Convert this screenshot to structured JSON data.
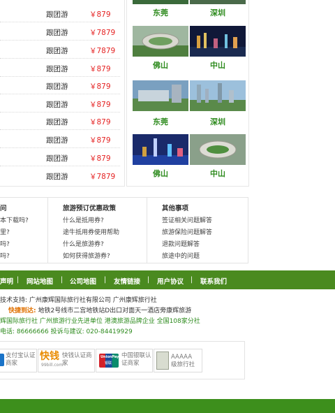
{
  "tours": [
    {
      "type": "跟团游",
      "price": "￥879"
    },
    {
      "type": "跟团游",
      "price": "￥7879"
    },
    {
      "type": "跟团游",
      "price": "￥7879"
    },
    {
      "type": "跟团游",
      "price": "￥879"
    },
    {
      "type": "跟团游",
      "price": "￥879"
    },
    {
      "type": "跟团游",
      "price": "￥879"
    },
    {
      "type": "跟团游",
      "price": "￥879"
    },
    {
      "type": "跟团游",
      "price": "￥879"
    },
    {
      "type": "跟团游",
      "price": "￥879"
    },
    {
      "type": "跟团游",
      "price": "￥7879"
    }
  ],
  "cities": [
    "东莞",
    "深圳",
    "佛山",
    "中山",
    "东莞",
    "深圳",
    "佛山",
    "中山"
  ],
  "help": {
    "col1": {
      "title": "问",
      "links": [
        "本下载吗?",
        "里?",
        "吗?",
        "吗?"
      ]
    },
    "col2": {
      "title": "旅游预订优惠政策",
      "links": [
        "什么是抵用券?",
        "途牛抵用券使用帮助",
        "什么是旅游券?",
        "如何获得旅游券?"
      ]
    },
    "col3": {
      "title": "其他事项",
      "links": [
        "签证相关问题解答",
        "旅游保险问题解答",
        "退款问题解答",
        "旅途中的问题"
      ]
    }
  },
  "nav": [
    "声明",
    "网站地图",
    "公司地图",
    "友情链接",
    "用户协议",
    "联系我们"
  ],
  "footer": {
    "tech_support": "技术支持: 广州康辉国际旅行社有限公司 广州康辉旅行社",
    "route_label": "快捷到达:",
    "route_text": "地铁2号线市二宫地铁站D出口对面天一酒店旁康辉旅游",
    "awards": "辉国际旅行社 广州旅游行业先进单位 港澳旅游品牌企业 全国108家分社",
    "phone": "电话: 86666666 投诉与建议: 020-84419929"
  },
  "badges": [
    {
      "name": "alipay-badge",
      "line1": "支付宝认证",
      "line2": "商家"
    },
    {
      "name": "99bill-badge",
      "logo": "快钱",
      "sub": "99bill.com",
      "line1": "快钱认证商",
      "line2": "家"
    },
    {
      "name": "unionpay-badge",
      "logo": "UnionPay",
      "sub": "银联",
      "line1": "中国银联认",
      "line2": "证商家"
    },
    {
      "name": "aaaaa-badge",
      "line1": "AAAAA",
      "line2": "级旅行社"
    }
  ],
  "colors": {
    "green": "#4a8a1f",
    "price_red": "#e52222",
    "city_green": "#2e8b1e"
  }
}
